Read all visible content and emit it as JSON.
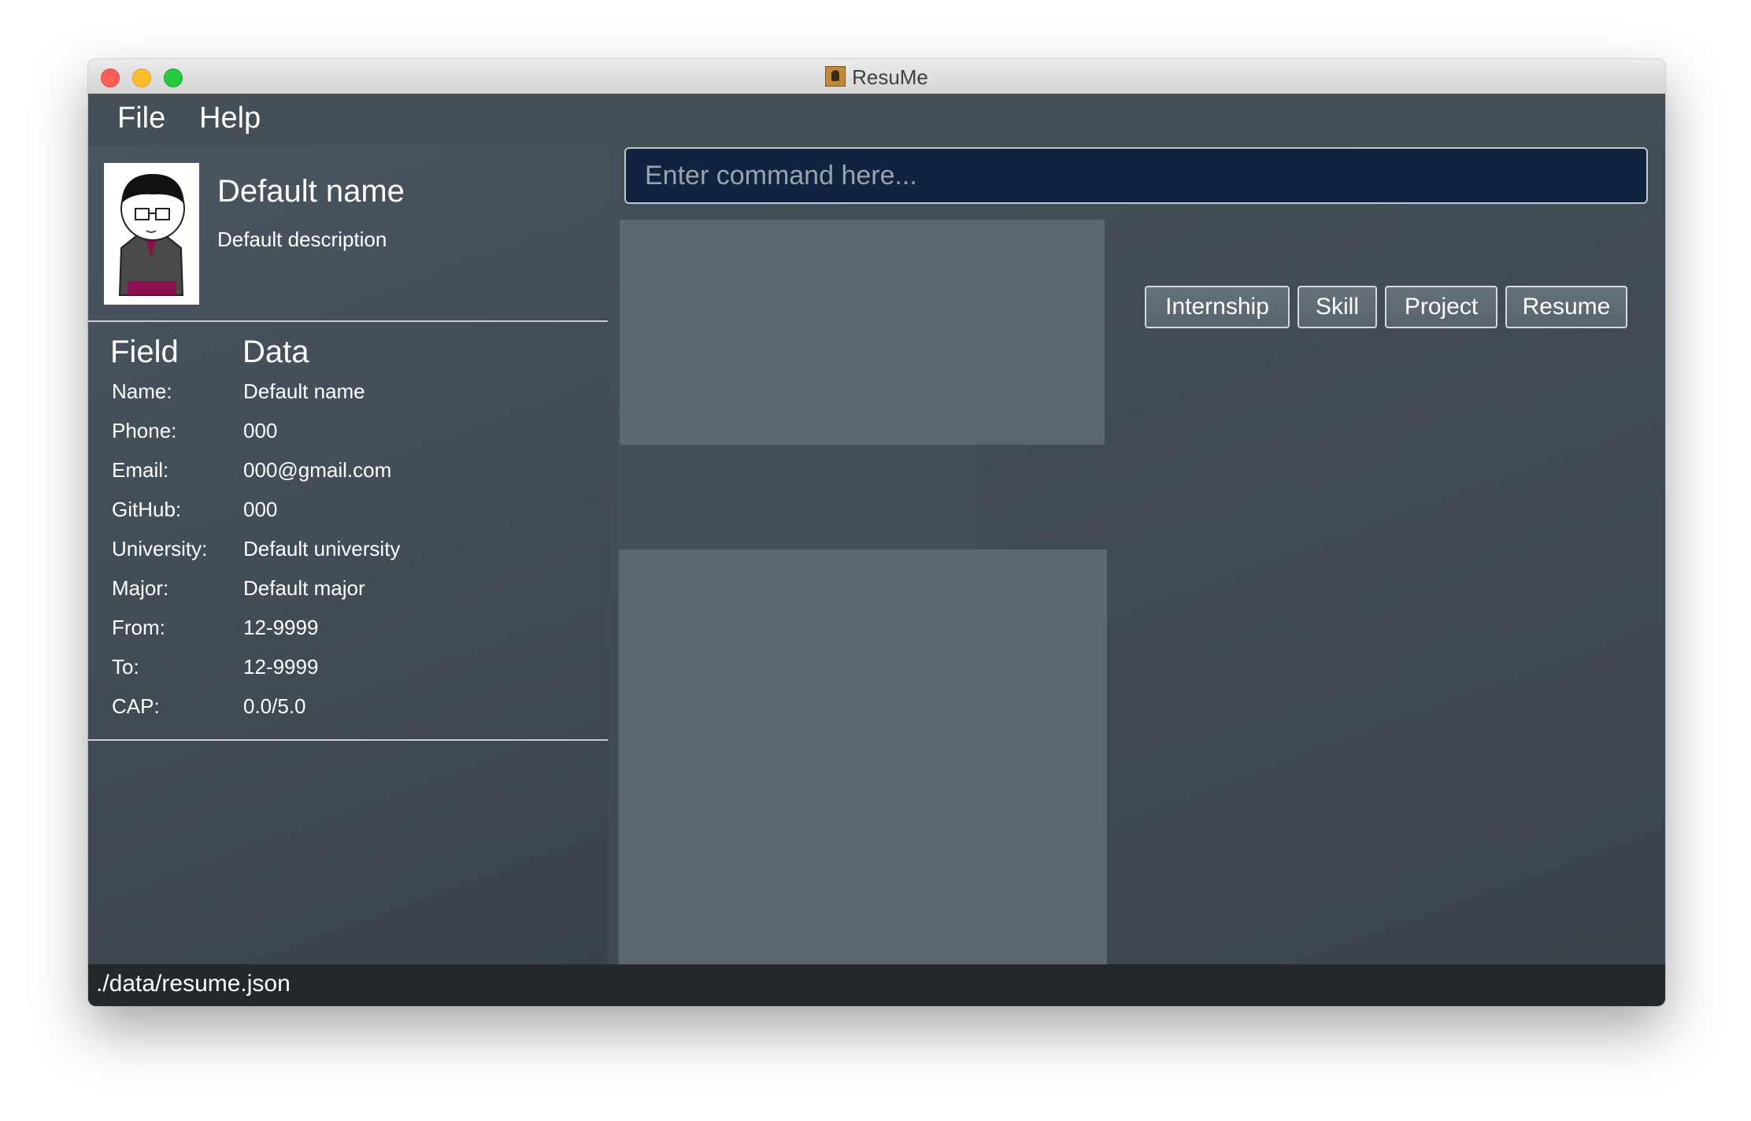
{
  "window": {
    "title": "ResuMe"
  },
  "menu": {
    "file": "File",
    "help": "Help"
  },
  "profile": {
    "name": "Default name",
    "description": "Default description"
  },
  "table": {
    "header_field": "Field",
    "header_data": "Data",
    "rows": [
      {
        "label": "Name:",
        "value": "Default name"
      },
      {
        "label": "Phone:",
        "value": "000"
      },
      {
        "label": "Email:",
        "value": "000@gmail.com"
      },
      {
        "label": "GitHub:",
        "value": "000"
      },
      {
        "label": "University:",
        "value": "Default university"
      },
      {
        "label": "Major:",
        "value": "Default major"
      },
      {
        "label": "From:",
        "value": "12-9999"
      },
      {
        "label": "To:",
        "value": "12-9999"
      },
      {
        "label": "CAP:",
        "value": "0.0/5.0"
      }
    ]
  },
  "command": {
    "placeholder": "Enter command here..."
  },
  "tabs": {
    "internship": "Internship",
    "skill": "Skill",
    "project": "Project",
    "resume": "Resume"
  },
  "status": {
    "path": "./data/resume.json"
  },
  "colors": {
    "command_bg": "#102440",
    "panel_bg": "#3e4851",
    "card_bg": "#5b6770",
    "status_bg": "#23282d"
  }
}
